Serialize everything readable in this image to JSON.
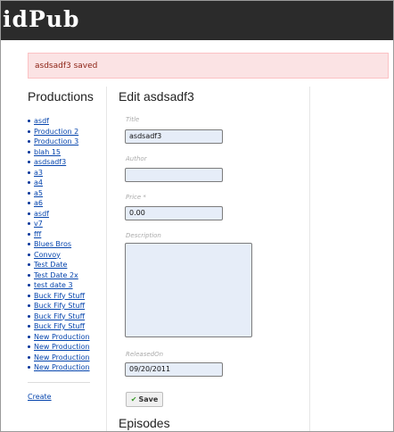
{
  "header": {
    "title": "idPub"
  },
  "flash": {
    "message": "asdsadf3 saved"
  },
  "sidebar": {
    "heading": "Productions",
    "items": [
      "asdf",
      "Production 2",
      "Production 3",
      "blah 15",
      "asdsadf3",
      "a3",
      "a4",
      "a5",
      "a6",
      "asdf",
      "v7",
      "fff",
      "Blues Bros",
      "Convoy",
      "Test Date",
      "Test Date 2x",
      "test date 3",
      "Buck Fify Stuff",
      "Buck Fify Stuff",
      "Buck Fify Stuff",
      "Buck Fify Stuff",
      "New Production",
      "New Production",
      "New Production",
      "New Production"
    ],
    "create_label": "Create"
  },
  "form": {
    "heading": "Edit asdsadf3",
    "title_label": "Title",
    "title_value": "asdsadf3",
    "author_label": "Author",
    "author_value": "",
    "price_label": "Price *",
    "price_value": "0.00",
    "description_label": "Description",
    "description_value": "",
    "released_label": "ReleasedOn",
    "released_value": "09/20/2011",
    "save_label": "Save",
    "save_icon": "checkmark-icon"
  },
  "episodes": {
    "heading": "Episodes"
  }
}
